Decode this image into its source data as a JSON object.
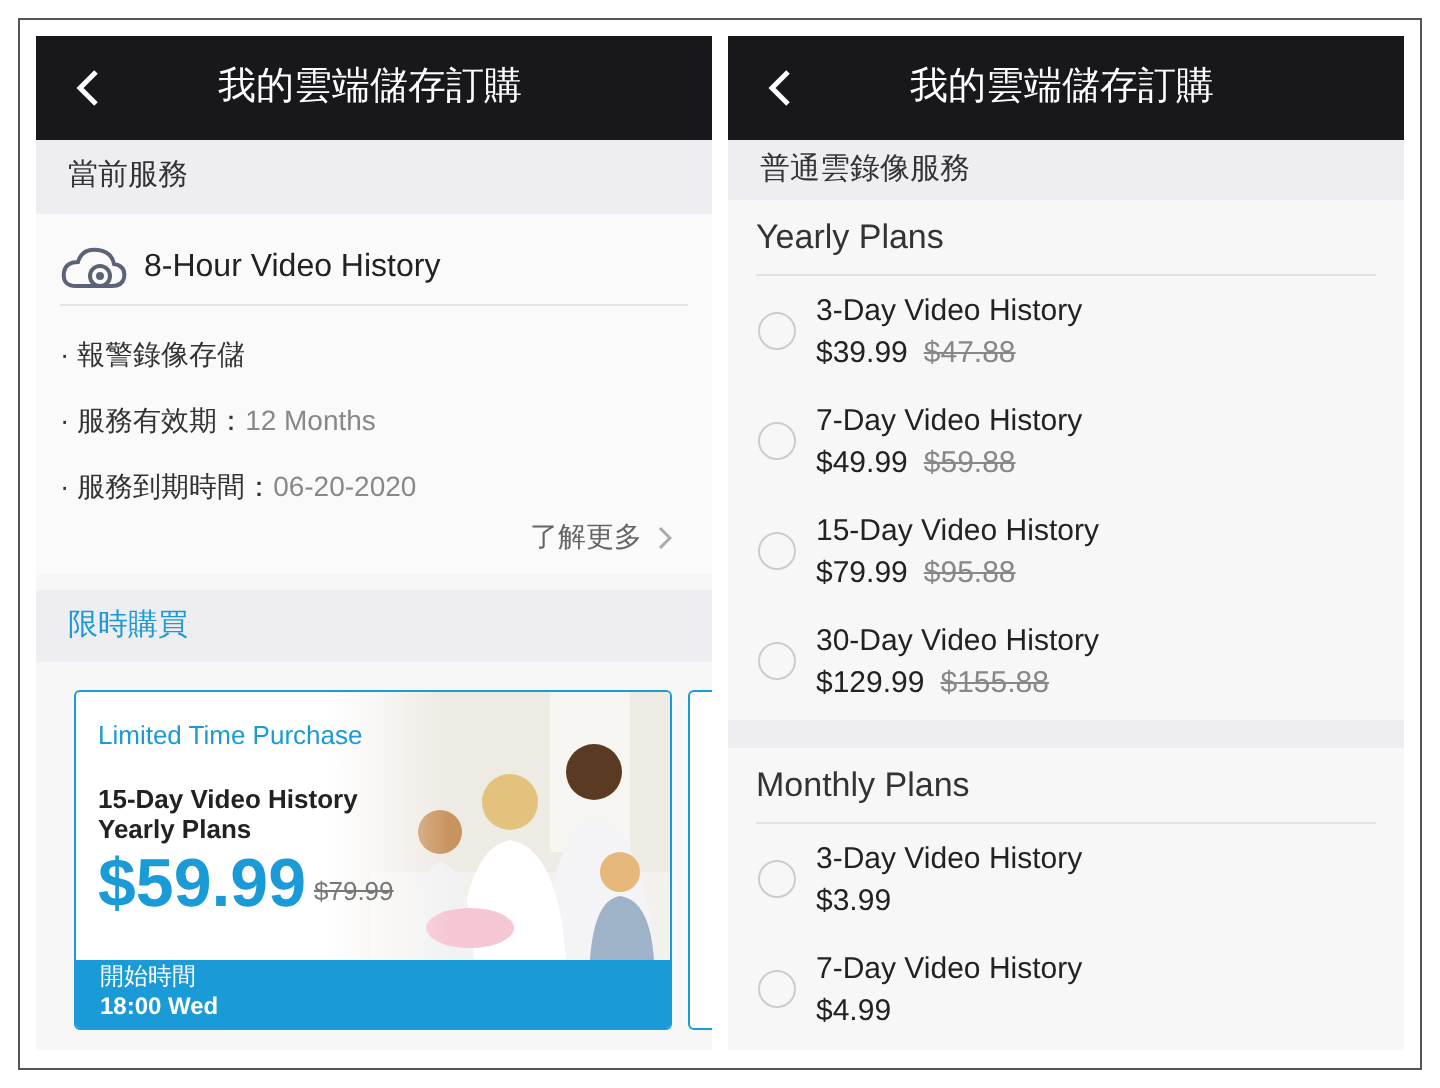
{
  "screens": [
    {
      "title": "我的雲端儲存訂購",
      "current_service": {
        "heading": "當前服務",
        "plan": "8-Hour Video History",
        "details": [
          {
            "label": "· 報警錄像存儲"
          },
          {
            "label": "· 服務有效期：",
            "value": "12 Months"
          },
          {
            "label": "· 服務到期時間：",
            "value": "06-20-2020"
          }
        ],
        "more_link": "了解更多"
      },
      "promo": {
        "heading": "限時購買",
        "card": {
          "tag": "Limited Time Purchase",
          "plan_line_1": "15-Day Video History",
          "plan_line_2": "Yearly Plans",
          "price": "$59.99",
          "old_price": "$79.99",
          "start_label": "開始時間",
          "start_time": "18:00 Wed"
        }
      }
    },
    {
      "title": "我的雲端儲存訂購",
      "section_heading": "普通雲錄像服務",
      "groups": [
        {
          "title": "Yearly Plans",
          "plans": [
            {
              "name": "3-Day Video History",
              "price": "$39.99",
              "old_price": "$47.88",
              "selected": false
            },
            {
              "name": "7-Day Video History",
              "price": "$49.99",
              "old_price": "$59.88",
              "selected": false
            },
            {
              "name": "15-Day Video History",
              "price": "$79.99",
              "old_price": "$95.88",
              "selected": false
            },
            {
              "name": "30-Day Video History",
              "price": "$129.99",
              "old_price": "$155.88",
              "selected": false
            }
          ]
        },
        {
          "title": "Monthly Plans",
          "plans": [
            {
              "name": "3-Day Video History",
              "price": "$3.99",
              "selected": false
            },
            {
              "name": "7-Day Video History",
              "price": "$4.99",
              "selected": false
            }
          ]
        }
      ]
    }
  ]
}
